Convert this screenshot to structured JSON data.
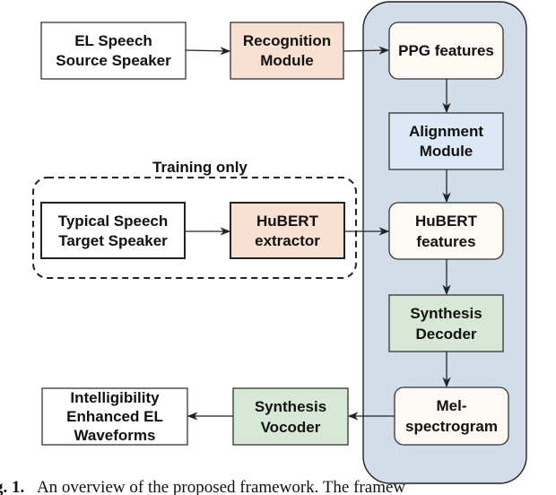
{
  "diagram": {
    "colors": {
      "container": "#d1dde8",
      "feature_box": "#fdf9f5",
      "alignment_box": "#dce8f5",
      "recognition_box": "#f8e0d2",
      "synthesis_box": "#d8e8d6",
      "plain_box": "#ffffff",
      "stroke": "#222222"
    },
    "training_label": "Training only",
    "nodes": {
      "el_speech": [
        "EL Speech",
        "Source Speaker"
      ],
      "recognition": [
        "Recognition",
        "Module"
      ],
      "ppg": [
        "PPG features"
      ],
      "alignment": [
        "Alignment",
        "Module"
      ],
      "typical_speech": [
        "Typical Speech",
        "Target Speaker"
      ],
      "hubert_extractor": [
        "HuBERT",
        "extractor"
      ],
      "hubert_features": [
        "HuBERT",
        "features"
      ],
      "synthesis_decoder": [
        "Synthesis",
        "Decoder"
      ],
      "mel": [
        "Mel-",
        "spectrogram"
      ],
      "synthesis_vocoder": [
        "Synthesis",
        "Vocoder"
      ],
      "output": [
        "Intelligibility",
        "Enhanced EL",
        "Waveforms"
      ]
    },
    "edges": [
      [
        "el_speech",
        "recognition"
      ],
      [
        "recognition",
        "ppg"
      ],
      [
        "ppg",
        "alignment"
      ],
      [
        "alignment",
        "hubert_features"
      ],
      [
        "typical_speech",
        "hubert_extractor"
      ],
      [
        "hubert_extractor",
        "hubert_features"
      ],
      [
        "hubert_features",
        "synthesis_decoder"
      ],
      [
        "synthesis_decoder",
        "mel"
      ],
      [
        "mel",
        "synthesis_vocoder"
      ],
      [
        "synthesis_vocoder",
        "output"
      ]
    ]
  },
  "caption": {
    "prefix": "g. 1.",
    "text": "An overview of the proposed framework.  The framew"
  }
}
